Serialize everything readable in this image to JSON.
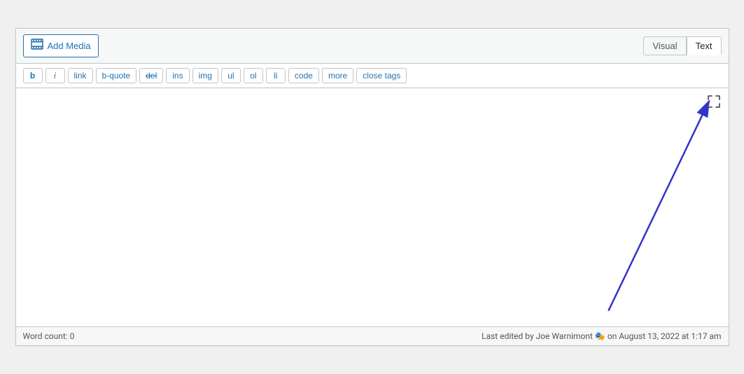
{
  "header": {
    "add_media_label": "Add Media",
    "tab_visual": "Visual",
    "tab_text": "Text"
  },
  "toolbar": {
    "buttons": [
      {
        "label": "b",
        "style": "bold",
        "name": "bold-btn"
      },
      {
        "label": "i",
        "style": "italic",
        "name": "italic-btn"
      },
      {
        "label": "link",
        "style": "normal",
        "name": "link-btn"
      },
      {
        "label": "b-quote",
        "style": "normal",
        "name": "bquote-btn"
      },
      {
        "label": "del",
        "style": "strikethrough",
        "name": "del-btn"
      },
      {
        "label": "ins",
        "style": "normal",
        "name": "ins-btn"
      },
      {
        "label": "img",
        "style": "normal",
        "name": "img-btn"
      },
      {
        "label": "ul",
        "style": "normal",
        "name": "ul-btn"
      },
      {
        "label": "ol",
        "style": "normal",
        "name": "ol-btn"
      },
      {
        "label": "li",
        "style": "normal",
        "name": "li-btn"
      },
      {
        "label": "code",
        "style": "normal",
        "name": "code-btn"
      },
      {
        "label": "more",
        "style": "normal",
        "name": "more-btn"
      },
      {
        "label": "close tags",
        "style": "normal",
        "name": "close-tags-btn"
      }
    ]
  },
  "footer": {
    "word_count_label": "Word count: 0",
    "last_edited": "Last edited by Joe Warnimont",
    "emoji": "🎭",
    "date": "on August 13, 2022 at 1:17 am"
  },
  "fullscreen": {
    "icon": "⤢"
  },
  "icons": {
    "add_media": "🖼"
  }
}
